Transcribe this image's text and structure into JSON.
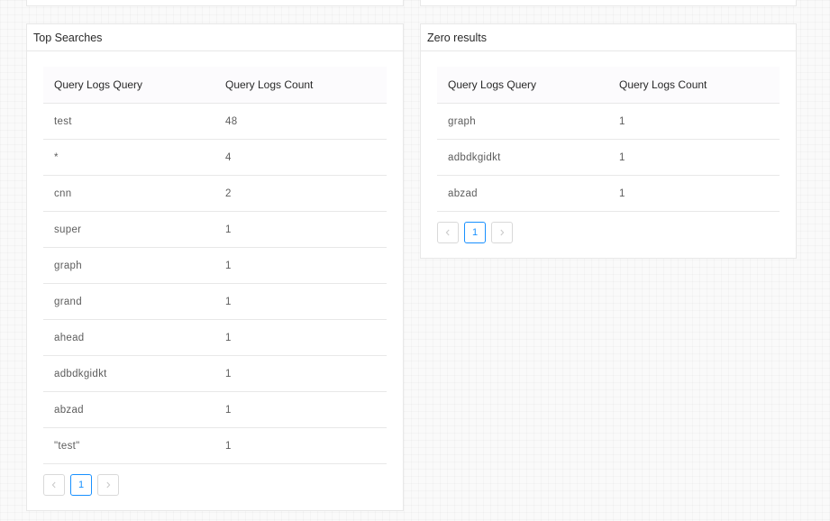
{
  "colors": {
    "accent": "#1890ff",
    "border": "#e8e8e8",
    "header_bg": "#fcfbfd"
  },
  "top_searches": {
    "title": "Top Searches",
    "columns": [
      "Query Logs Query",
      "Query Logs Count"
    ],
    "rows": [
      {
        "query": "test",
        "count": "48"
      },
      {
        "query": "*",
        "count": "4"
      },
      {
        "query": "cnn",
        "count": "2"
      },
      {
        "query": "super",
        "count": "1"
      },
      {
        "query": "graph",
        "count": "1"
      },
      {
        "query": "grand",
        "count": "1"
      },
      {
        "query": "ahead",
        "count": "1"
      },
      {
        "query": "adbdkgidkt",
        "count": "1"
      },
      {
        "query": "abzad",
        "count": "1"
      },
      {
        "query": "\"test\"",
        "count": "1"
      }
    ],
    "pagination": {
      "prev_icon": "chevron-left-icon",
      "current_page": "1",
      "next_icon": "chevron-right-icon"
    }
  },
  "zero_results": {
    "title": "Zero results",
    "columns": [
      "Query Logs Query",
      "Query Logs Count"
    ],
    "rows": [
      {
        "query": "graph",
        "count": "1"
      },
      {
        "query": "adbdkgidkt",
        "count": "1"
      },
      {
        "query": "abzad",
        "count": "1"
      }
    ],
    "pagination": {
      "prev_icon": "chevron-left-icon",
      "current_page": "1",
      "next_icon": "chevron-right-icon"
    }
  }
}
